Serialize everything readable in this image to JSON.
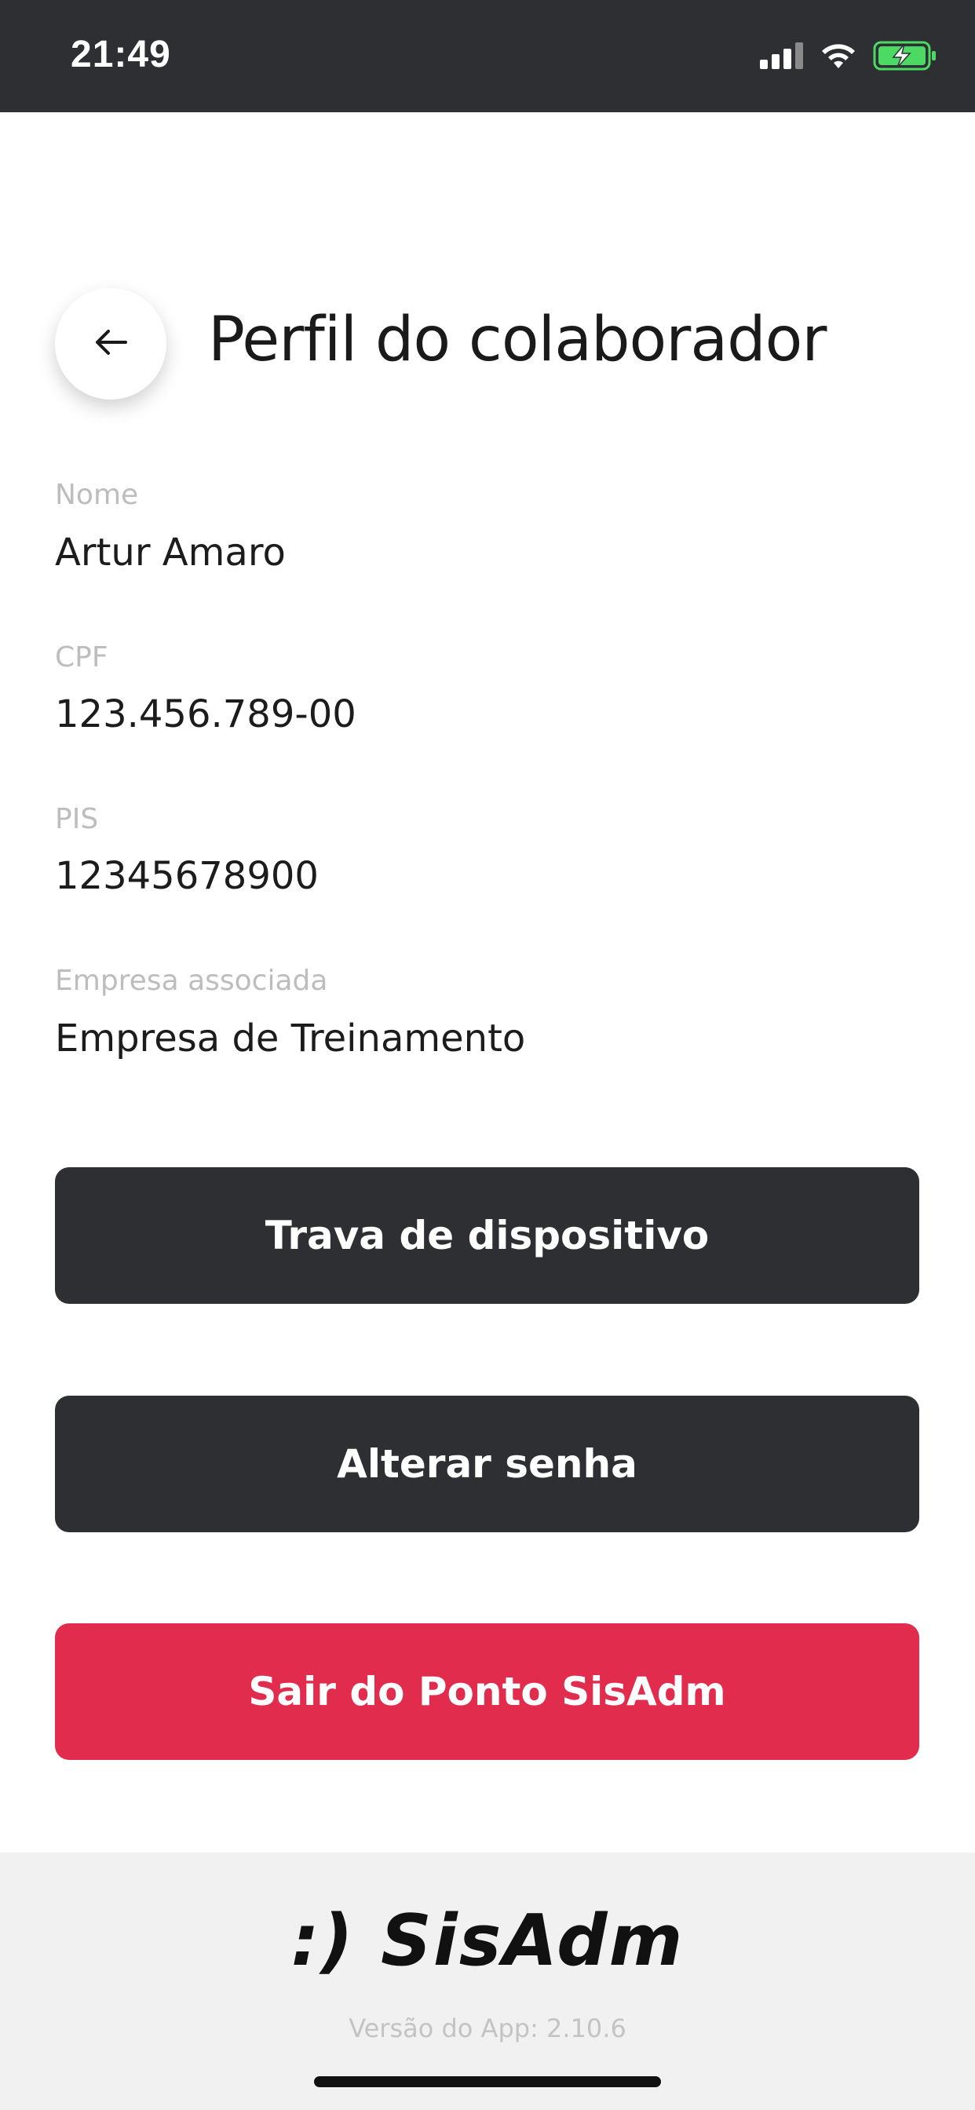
{
  "status_bar": {
    "time": "21:49",
    "icons": [
      "cellular-signal-icon",
      "wifi-icon",
      "battery-charging-icon"
    ]
  },
  "header": {
    "back_icon": "arrow-left-icon",
    "title": "Perfil do colaborador"
  },
  "fields": [
    {
      "label": "Nome",
      "value": "Artur Amaro"
    },
    {
      "label": "CPF",
      "value": "123.456.789-00"
    },
    {
      "label": "PIS",
      "value": "12345678900"
    },
    {
      "label": "Empresa associada",
      "value": "Empresa de Treinamento"
    }
  ],
  "buttons": {
    "device_lock": "Trava de dispositivo",
    "change_password": "Alterar senha",
    "logout": "Sair do Ponto SisAdm"
  },
  "footer": {
    "logo_text": ":) SisAdm",
    "version": "Versão do App: 2.10.6"
  },
  "colors": {
    "dark": "#2d2f33",
    "danger": "#e22c4d",
    "label_gray": "#bdbdbd",
    "footer_bg": "#f1f1f1",
    "battery_green": "#4cd964"
  }
}
